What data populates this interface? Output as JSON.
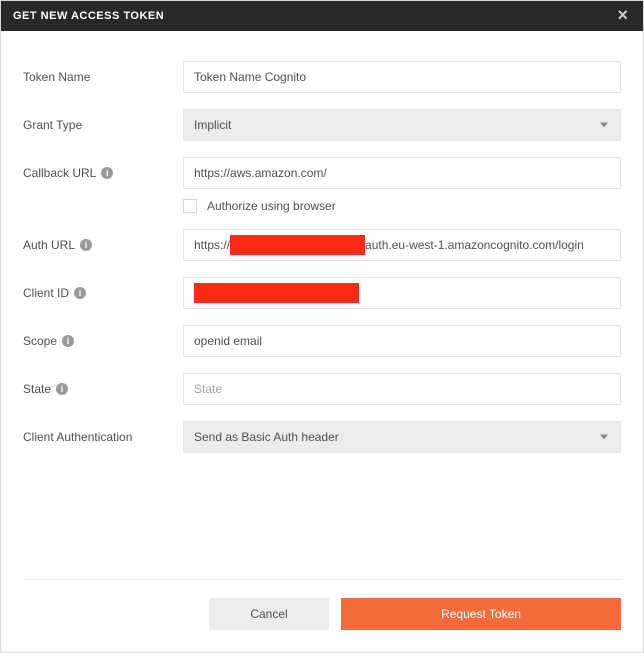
{
  "titlebar": {
    "title": "GET NEW ACCESS TOKEN"
  },
  "fields": {
    "token_name": {
      "label": "Token Name",
      "value": "Token Name Cognito"
    },
    "grant_type": {
      "label": "Grant Type",
      "selected": "Implicit"
    },
    "callback_url": {
      "label": "Callback URL",
      "value": "https://aws.amazon.com/"
    },
    "authorize_browser": {
      "label": "Authorize using browser",
      "checked": false
    },
    "auth_url": {
      "label": "Auth URL",
      "prefix": "https://",
      "suffix": "auth.eu-west-1.amazoncognito.com/login",
      "redacted": true
    },
    "client_id": {
      "label": "Client ID",
      "redacted": true
    },
    "scope": {
      "label": "Scope",
      "value": "openid email"
    },
    "state": {
      "label": "State",
      "placeholder": "State",
      "value": ""
    },
    "client_auth": {
      "label": "Client Authentication",
      "selected": "Send as Basic Auth header"
    }
  },
  "footer": {
    "cancel": "Cancel",
    "request": "Request Token"
  }
}
